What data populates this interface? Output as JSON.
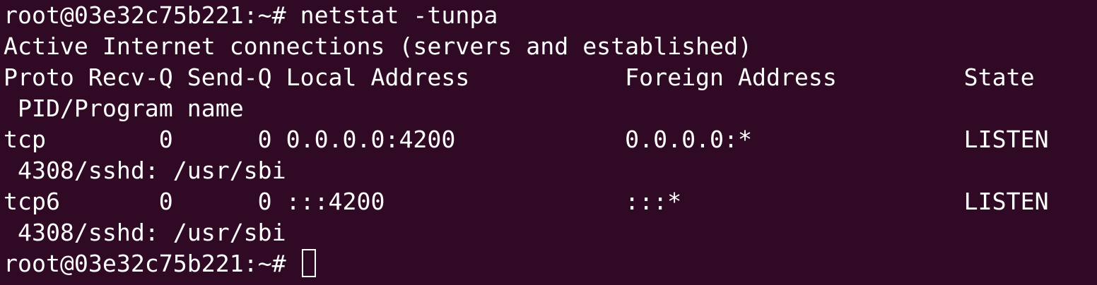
{
  "terminal": {
    "lines": [
      "root@03e32c75b221:~# netstat -tunpa",
      "Active Internet connections (servers and established)",
      "Proto Recv-Q Send-Q Local Address           Foreign Address         State      ",
      " PID/Program name",
      "tcp        0      0 0.0.0.0:4200            0.0.0.0:*               LISTEN     ",
      " 4308/sshd: /usr/sbi",
      "tcp6       0      0 :::4200                 :::*                    LISTEN     ",
      " 4308/sshd: /usr/sbi"
    ],
    "prompt": "root@03e32c75b221:~# ",
    "colors": {
      "background": "#300a24",
      "foreground": "#ffffff"
    }
  }
}
